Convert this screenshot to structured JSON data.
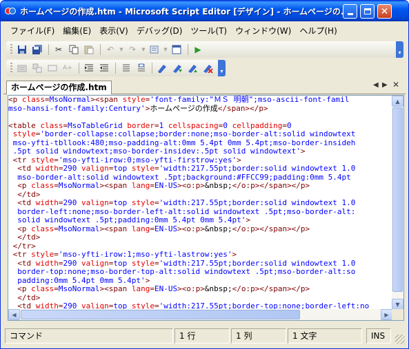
{
  "window": {
    "title": "ホームページの作成.htm - Microsoft Script Editor [デザイン] - ホームページの...",
    "controls": [
      "minimize",
      "maximize",
      "close"
    ]
  },
  "menu": [
    "ファイル(F)",
    "編集(E)",
    "表示(V)",
    "デバッグ(D)",
    "ツール(T)",
    "ウィンドウ(W)",
    "ヘルプ(H)"
  ],
  "toolbar1": {
    "icons": [
      "save-icon",
      "save-all-icon",
      "cut-icon",
      "copy-icon",
      "paste-icon",
      "undo-icon",
      "redo-icon",
      "navigate-icon",
      "window-icon",
      "run-icon"
    ]
  },
  "toolbar2": {
    "icons": [
      "toolbox-icon",
      "list-members-icon",
      "parameter-info-icon",
      "complete-word-icon",
      "indent-icon",
      "outdent-icon",
      "comment-icon",
      "uncomment-icon",
      "toggle-bookmark-icon",
      "next-bookmark-icon",
      "prev-bookmark-icon",
      "clear-bookmarks-icon"
    ]
  },
  "document": {
    "tab_label": "ホームページの作成.htm"
  },
  "code": [
    [
      [
        "tag",
        "<p "
      ],
      [
        "attr",
        "class"
      ],
      [
        "tag",
        "="
      ],
      [
        "val",
        "MsoNormal"
      ],
      [
        "tag",
        "><span "
      ],
      [
        "attr",
        "style"
      ],
      [
        "tag",
        "="
      ],
      [
        "val",
        "'font-family:\"ＭＳ 明朝\";mso-ascii-font-famil"
      ]
    ],
    [
      [
        "val",
        "mso-hansi-font-family:Century'"
      ],
      [
        "tag",
        ">"
      ],
      [
        "txt",
        "ホームページの作成"
      ],
      [
        "tag",
        "</span></p>"
      ]
    ],
    [],
    [
      [
        "tag",
        "<table "
      ],
      [
        "attr",
        "class"
      ],
      [
        "tag",
        "="
      ],
      [
        "val",
        "MsoTableGrid "
      ],
      [
        "attr",
        "border"
      ],
      [
        "tag",
        "="
      ],
      [
        "val",
        "1 "
      ],
      [
        "attr",
        "cellspacing"
      ],
      [
        "tag",
        "="
      ],
      [
        "val",
        "0 "
      ],
      [
        "attr",
        "cellpadding"
      ],
      [
        "tag",
        "="
      ],
      [
        "val",
        "0"
      ]
    ],
    [
      [
        "tag",
        " "
      ],
      [
        "attr",
        "style"
      ],
      [
        "tag",
        "="
      ],
      [
        "val",
        "'border-collapse:collapse;border:none;mso-border-alt:solid windowtext"
      ]
    ],
    [
      [
        "val",
        " mso-yfti-tbllook:480;mso-padding-alt:0mm 5.4pt 0mm 5.4pt;mso-border-insideh"
      ]
    ],
    [
      [
        "val",
        " .5pt solid windowtext;mso-border-insidev:.5pt solid windowtext'"
      ],
      [
        "tag",
        ">"
      ]
    ],
    [
      [
        "tag",
        " <tr "
      ],
      [
        "attr",
        "style"
      ],
      [
        "tag",
        "="
      ],
      [
        "val",
        "'mso-yfti-irow:0;mso-yfti-firstrow:yes'"
      ],
      [
        "tag",
        ">"
      ]
    ],
    [
      [
        "tag",
        "  <td "
      ],
      [
        "attr",
        "width"
      ],
      [
        "tag",
        "="
      ],
      [
        "val",
        "290 "
      ],
      [
        "attr",
        "valign"
      ],
      [
        "tag",
        "="
      ],
      [
        "val",
        "top "
      ],
      [
        "attr",
        "style"
      ],
      [
        "tag",
        "="
      ],
      [
        "val",
        "'width:217.55pt;border:solid windowtext 1.0"
      ]
    ],
    [
      [
        "val",
        "  mso-border-alt:solid windowtext .5pt;background:#FFCC99;padding:0mm 5.4pt"
      ]
    ],
    [
      [
        "tag",
        "  <p "
      ],
      [
        "attr",
        "class"
      ],
      [
        "tag",
        "="
      ],
      [
        "val",
        "MsoNormal"
      ],
      [
        "tag",
        "><span "
      ],
      [
        "attr",
        "lang"
      ],
      [
        "tag",
        "="
      ],
      [
        "val",
        "EN-US"
      ],
      [
        "tag",
        "><o:p>"
      ],
      [
        "txt",
        "&nbsp;"
      ],
      [
        "tag",
        "</o:p></span></p>"
      ]
    ],
    [
      [
        "tag",
        "  </td>"
      ]
    ],
    [
      [
        "tag",
        "  <td "
      ],
      [
        "attr",
        "width"
      ],
      [
        "tag",
        "="
      ],
      [
        "val",
        "290 "
      ],
      [
        "attr",
        "valign"
      ],
      [
        "tag",
        "="
      ],
      [
        "val",
        "top "
      ],
      [
        "attr",
        "style"
      ],
      [
        "tag",
        "="
      ],
      [
        "val",
        "'width:217.55pt;border:solid windowtext 1.0"
      ]
    ],
    [
      [
        "val",
        "  border-left:none;mso-border-left-alt:solid windowtext .5pt;mso-border-alt:"
      ]
    ],
    [
      [
        "val",
        "  solid windowtext .5pt;padding:0mm 5.4pt 0mm 5.4pt'"
      ],
      [
        "tag",
        ">"
      ]
    ],
    [
      [
        "tag",
        "  <p "
      ],
      [
        "attr",
        "class"
      ],
      [
        "tag",
        "="
      ],
      [
        "val",
        "MsoNormal"
      ],
      [
        "tag",
        "><span "
      ],
      [
        "attr",
        "lang"
      ],
      [
        "tag",
        "="
      ],
      [
        "val",
        "EN-US"
      ],
      [
        "tag",
        "><o:p>"
      ],
      [
        "txt",
        "&nbsp;"
      ],
      [
        "tag",
        "</o:p></span></p>"
      ]
    ],
    [
      [
        "tag",
        "  </td>"
      ]
    ],
    [
      [
        "tag",
        " </tr>"
      ]
    ],
    [
      [
        "tag",
        " <tr "
      ],
      [
        "attr",
        "style"
      ],
      [
        "tag",
        "="
      ],
      [
        "val",
        "'mso-yfti-irow:1;mso-yfti-lastrow:yes'"
      ],
      [
        "tag",
        ">"
      ]
    ],
    [
      [
        "tag",
        "  <td "
      ],
      [
        "attr",
        "width"
      ],
      [
        "tag",
        "="
      ],
      [
        "val",
        "290 "
      ],
      [
        "attr",
        "valign"
      ],
      [
        "tag",
        "="
      ],
      [
        "val",
        "top "
      ],
      [
        "attr",
        "style"
      ],
      [
        "tag",
        "="
      ],
      [
        "val",
        "'width:217.55pt;border:solid windowtext 1.0"
      ]
    ],
    [
      [
        "val",
        "  border-top:none;mso-border-top-alt:solid windowtext .5pt;mso-border-alt:so"
      ]
    ],
    [
      [
        "val",
        "  padding:0mm 5.4pt 0mm 5.4pt'"
      ],
      [
        "tag",
        ">"
      ]
    ],
    [
      [
        "tag",
        "  <p "
      ],
      [
        "attr",
        "class"
      ],
      [
        "tag",
        "="
      ],
      [
        "val",
        "MsoNormal"
      ],
      [
        "tag",
        "><span "
      ],
      [
        "attr",
        "lang"
      ],
      [
        "tag",
        "="
      ],
      [
        "val",
        "EN-US"
      ],
      [
        "tag",
        "><o:p>"
      ],
      [
        "txt",
        "&nbsp;"
      ],
      [
        "tag",
        "</o:p></span></p>"
      ]
    ],
    [
      [
        "tag",
        "  </td>"
      ]
    ],
    [
      [
        "tag",
        "  <td "
      ],
      [
        "attr",
        "width"
      ],
      [
        "tag",
        "="
      ],
      [
        "val",
        "290 "
      ],
      [
        "attr",
        "valign"
      ],
      [
        "tag",
        "="
      ],
      [
        "val",
        "top "
      ],
      [
        "attr",
        "style"
      ],
      [
        "tag",
        "="
      ],
      [
        "val",
        "'width:217.55pt;border-top:none;border-left:no"
      ]
    ]
  ],
  "status": {
    "mode": "コマンド",
    "line": "1 行",
    "col": "1 列",
    "char": "1 文字",
    "ins": "INS"
  },
  "colors": {
    "tag": "#800000",
    "attribute": "#e00000",
    "value": "#0000ff",
    "title_bar": "#0058ee"
  }
}
